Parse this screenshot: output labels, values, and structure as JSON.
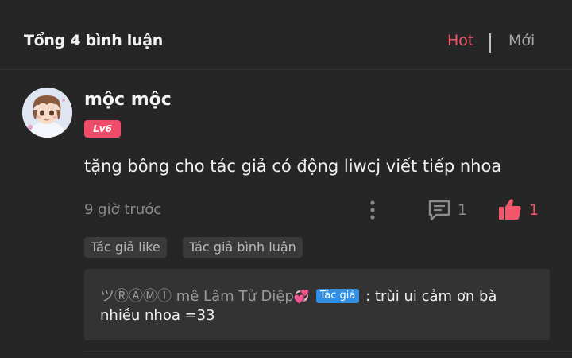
{
  "header": {
    "title": "Tổng 4 bình luận",
    "sort_hot": "Hot",
    "sort_new": "Mới"
  },
  "comment": {
    "username": "mộc mộc",
    "level": "Lv6",
    "text": "tặng bông cho tác giả có động liwcj viết tiếp nhoa",
    "time": "9 giờ trước",
    "reply_count": "1",
    "like_count": "1",
    "tags": [
      "Tác giả like",
      "Tác giả bình luận"
    ]
  },
  "reply": {
    "author": "ツⓇⒶⓂⒾ mê Lâm Tử Diệp",
    "author_badge": "Tác giả",
    "text_part1": ": trùi ui cảm ơn bà",
    "text_part2": "nhiều nhoa =33"
  },
  "colors": {
    "accent": "#f2566b",
    "background": "#262626",
    "badge_level": "#ee4c68",
    "badge_author": "#2d8fe6"
  },
  "icons": {
    "more": "more-vertical-icon",
    "reply": "comment-icon",
    "like": "thumbs-up-icon",
    "heart": "two-hearts-icon"
  }
}
